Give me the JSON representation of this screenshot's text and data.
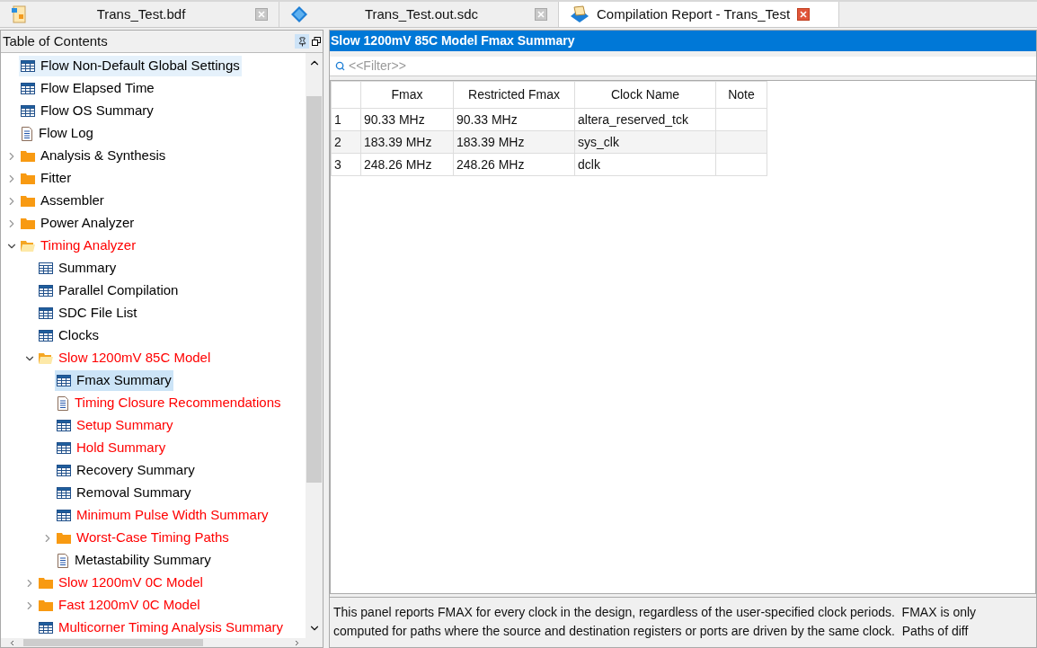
{
  "tabs": [
    {
      "label": "Trans_Test.bdf",
      "kind": "schematic",
      "selected": false
    },
    {
      "label": "Trans_Test.out.sdc",
      "kind": "sdc",
      "selected": false
    },
    {
      "label": "Compilation Report - Trans_Test",
      "kind": "report",
      "selected": true
    }
  ],
  "toc": {
    "title": "Table of Contents",
    "items": [
      {
        "label": "Flow Non-Default Global Settings",
        "kind": "table",
        "color": "#000000",
        "selected": false,
        "hovered": true
      },
      {
        "label": "Flow Elapsed Time",
        "kind": "table",
        "color": "#000000",
        "selected": false,
        "hovered": false
      },
      {
        "label": "Flow OS Summary",
        "kind": "table",
        "color": "#000000",
        "selected": false,
        "hovered": false
      },
      {
        "label": "Flow Log",
        "kind": "doc",
        "color": "#000000",
        "selected": false,
        "hovered": false
      },
      {
        "label": "Analysis & Synthesis",
        "kind": "folder",
        "color": "#000000",
        "expanded": false,
        "selected": false,
        "hovered": false
      },
      {
        "label": "Fitter",
        "kind": "folder",
        "color": "#000000",
        "expanded": false,
        "selected": false,
        "hovered": false
      },
      {
        "label": "Assembler",
        "kind": "folder",
        "color": "#000000",
        "expanded": false,
        "selected": false,
        "hovered": false
      },
      {
        "label": "Power Analyzer",
        "kind": "folder",
        "color": "#000000",
        "expanded": false,
        "selected": false,
        "hovered": false
      },
      {
        "label": "Timing Analyzer",
        "kind": "folder",
        "color": "#ff0000",
        "expanded": true,
        "selected": false,
        "hovered": false,
        "children": [
          {
            "label": "Summary",
            "kind": "table-plain",
            "color": "#000000",
            "selected": false,
            "hovered": false
          },
          {
            "label": "Parallel Compilation",
            "kind": "table",
            "color": "#000000",
            "selected": false,
            "hovered": false
          },
          {
            "label": "SDC File List",
            "kind": "table",
            "color": "#000000",
            "selected": false,
            "hovered": false
          },
          {
            "label": "Clocks",
            "kind": "table",
            "color": "#000000",
            "selected": false,
            "hovered": false
          },
          {
            "label": "Slow 1200mV 85C Model",
            "kind": "folder",
            "color": "#ff0000",
            "expanded": true,
            "selected": false,
            "hovered": false,
            "children": [
              {
                "label": "Fmax Summary",
                "kind": "table",
                "color": "#000000",
                "selected": true,
                "hovered": false
              },
              {
                "label": "Timing Closure Recommendations",
                "kind": "doc",
                "color": "#ff0000",
                "selected": false,
                "hovered": false
              },
              {
                "label": "Setup Summary",
                "kind": "table",
                "color": "#ff0000",
                "selected": false,
                "hovered": false
              },
              {
                "label": "Hold Summary",
                "kind": "table",
                "color": "#ff0000",
                "selected": false,
                "hovered": false
              },
              {
                "label": "Recovery Summary",
                "kind": "table",
                "color": "#000000",
                "selected": false,
                "hovered": false
              },
              {
                "label": "Removal Summary",
                "kind": "table",
                "color": "#000000",
                "selected": false,
                "hovered": false
              },
              {
                "label": "Minimum Pulse Width Summary",
                "kind": "table",
                "color": "#ff0000",
                "selected": false,
                "hovered": false
              },
              {
                "label": "Worst-Case Timing Paths",
                "kind": "folder",
                "color": "#ff0000",
                "expanded": false,
                "selected": false,
                "hovered": false
              },
              {
                "label": "Metastability Summary",
                "kind": "doc",
                "color": "#000000",
                "selected": false,
                "hovered": false
              }
            ]
          },
          {
            "label": "Slow 1200mV 0C Model",
            "kind": "folder",
            "color": "#ff0000",
            "expanded": false,
            "selected": false,
            "hovered": false
          },
          {
            "label": "Fast 1200mV 0C Model",
            "kind": "folder",
            "color": "#ff0000",
            "expanded": false,
            "selected": false,
            "hovered": false
          },
          {
            "label": "Multicorner Timing Analysis Summary",
            "kind": "table",
            "color": "#ff0000",
            "selected": false,
            "hovered": false
          }
        ]
      }
    ]
  },
  "report": {
    "title": "Slow 1200mV 85C Model Fmax Summary",
    "filter": {
      "placeholder": "<<Filter>>"
    },
    "table": {
      "columns": [
        "Fmax",
        "Restricted Fmax",
        "Clock Name",
        "Note"
      ],
      "rows": [
        {
          "index": "1",
          "cells": [
            "90.33 MHz",
            "90.33 MHz",
            "altera_reserved_tck",
            ""
          ]
        },
        {
          "index": "2",
          "cells": [
            "183.39 MHz",
            "183.39 MHz",
            "sys_clk",
            ""
          ]
        },
        {
          "index": "3",
          "cells": [
            "248.26 MHz",
            "248.26 MHz",
            "dclk",
            ""
          ]
        }
      ]
    },
    "description": [
      "This panel reports FMAX for every clock in the design, regardless of the user-specified clock periods.  FMAX is only",
      "computed for paths where the source and destination registers or ports are driven by the same clock.  Paths of diff"
    ]
  }
}
